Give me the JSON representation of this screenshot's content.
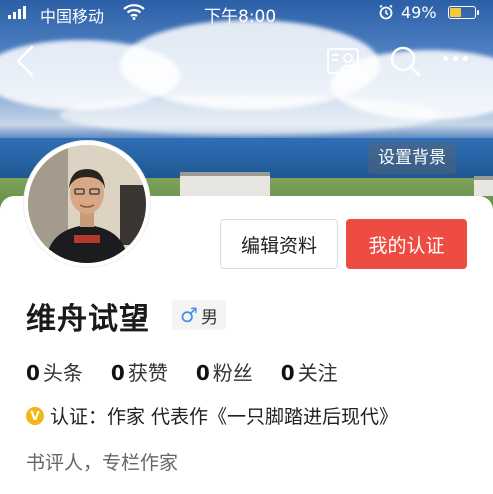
{
  "status_bar": {
    "carrier": "中国移动",
    "time": "下午8:00",
    "battery_percent": "49%",
    "battery_level": 0.49,
    "icons": [
      "signal-icon",
      "wifi-icon",
      "alarm-icon",
      "battery-icon"
    ]
  },
  "nav": {
    "icons": [
      "back-icon",
      "contact-card-icon",
      "search-icon",
      "more-icon"
    ]
  },
  "cover": {
    "set_background_label": "设置背景"
  },
  "profile": {
    "name": "维舟试望",
    "gender_symbol": "♂",
    "gender": "男",
    "edit_label": "编辑资料",
    "cert_label": "我的认证",
    "stats": [
      {
        "value": "0",
        "label": "头条"
      },
      {
        "value": "0",
        "label": "获赞"
      },
      {
        "value": "0",
        "label": "粉丝"
      },
      {
        "value": "0",
        "label": "关注"
      }
    ],
    "verify_badge": "V",
    "verification": "认证：作家 代表作《一只脚踏进后现代》",
    "bio": "书评人，专栏作家"
  },
  "colors": {
    "accent_red": "#ee4b43",
    "verify_gold": "#f2b616",
    "gender_blue": "#3f8ee8"
  }
}
